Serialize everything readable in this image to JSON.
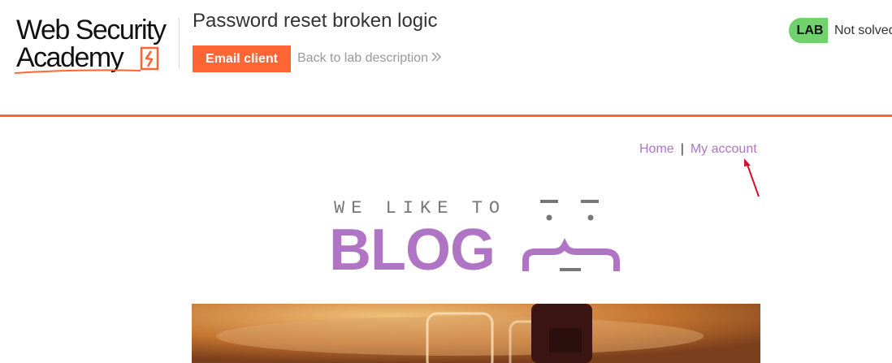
{
  "header": {
    "logo_line1": "Web Security",
    "logo_line2": "Academy",
    "lab_title": "Password reset broken logic",
    "email_client_label": "Email client",
    "back_link_label": "Back to lab description",
    "status": {
      "tag": "LAB",
      "state": "Not solved"
    }
  },
  "nav": {
    "home_label": "Home",
    "separator": "|",
    "account_label": "My account"
  },
  "blog_logo": {
    "tagline": "WE LIKE TO",
    "word": "BLOG"
  },
  "colors": {
    "accent_orange": "#ff6633",
    "link_purple": "#b074c4",
    "status_green": "#70d16d",
    "annotation_red": "#d4112c"
  },
  "icons": {
    "back_link": "double-chevron-right-icon",
    "annotation": "red-arrow-icon"
  }
}
